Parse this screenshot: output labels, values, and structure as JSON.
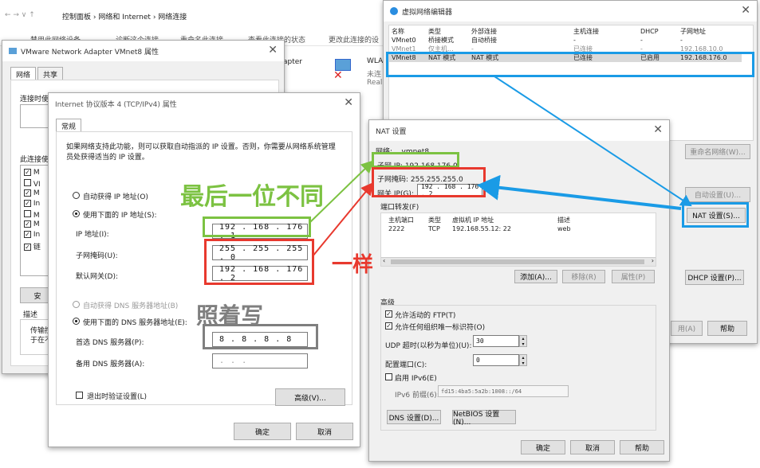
{
  "background_window": {
    "breadcrumb": [
      "控制面板",
      "网络和 Internet",
      "网络连接"
    ],
    "toolbar_items": [
      "禁用此网络设备",
      "诊断这个连接",
      "重命名此连接",
      "查看此连接的状态",
      "更改此连接的设"
    ],
    "adapter_partial": "apter",
    "wlan_partial": [
      "WLA",
      "未连",
      "Real"
    ]
  },
  "vmware_props": {
    "title": "VMware Network Adapter VMnet8 属性",
    "tabs": [
      "网络",
      "共享"
    ],
    "connect_using_partial": "连接时使",
    "this_connection_partial": "此连接使",
    "list_partial": [
      "M",
      "VI",
      "M",
      "In",
      "M",
      "M",
      "In",
      "链"
    ],
    "install_partial": "安",
    "desc_label": "描述",
    "desc_partial": [
      "传输控",
      "于在不"
    ]
  },
  "ipv4": {
    "title": "Internet 协议版本 4 (TCP/IPv4) 属性",
    "tab": "常规",
    "intro": "如果网络支持此功能，则可以获取自动指派的 IP 设置。否则，你需要从网络系统管理员处获得适当的 IP 设置。",
    "auto_ip": "自动获得 IP 地址(O)",
    "manual_ip": "使用下面的 IP 地址(S):",
    "ip_label": "IP 地址(I):",
    "ip_value": "192 . 168 . 176 .  1",
    "mask_label": "子网掩码(U):",
    "mask_value": "255 . 255 . 255 .  0",
    "gw_label": "默认网关(D):",
    "gw_value": "192 . 168 . 176 .  2",
    "auto_dns": "自动获得 DNS 服务器地址(B)",
    "manual_dns": "使用下面的 DNS 服务器地址(E):",
    "dns1_label": "首选 DNS 服务器(P):",
    "dns1_value": "8  .  8  .  8  .  8",
    "dns2_label": "备用 DNS 服务器(A):",
    "dns2_value": " .      .      .",
    "validate": "退出时验证设置(L)",
    "advanced": "高级(V)...",
    "ok": "确定",
    "cancel": "取消"
  },
  "vne": {
    "title": "虚拟网络编辑器",
    "headers": [
      "名称",
      "类型",
      "外部连接",
      "主机连接",
      "DHCP",
      "子网地址"
    ],
    "rows": [
      [
        "VMnet0",
        "桥接模式",
        "自动桥接",
        "-",
        "-",
        "-"
      ],
      [
        "VMnet1",
        "仅主机...",
        "-",
        "已连接",
        "-",
        "192.168.10.0"
      ],
      [
        "VMnet8",
        "NAT 模式",
        "NAT 模式",
        "已连接",
        "已启用",
        "192.168.176.0"
      ]
    ],
    "rename_net": "重命名网络(W)...",
    "auto_settings": "自动设置(U)...",
    "nat_settings": "NAT 设置(S)...",
    "dhcp_settings": "DHCP 设置(P)...",
    "apply_partial": "用(A)",
    "help": "帮助"
  },
  "nat": {
    "title": "NAT 设置",
    "network_label": "网络:",
    "network_value": "vmnet8",
    "subnet_ip": "子网 IP:   192.168.176.0",
    "subnet_mask": "子网掩码:  255.255.255.0",
    "gateway_label": "网关 IP(G):",
    "gateway_value": "192 . 168 . 176 .  2",
    "port_fwd": "端口转发(F)",
    "pf_headers": [
      "主机端口",
      "类型",
      "虚拟机 IP 地址",
      "描述"
    ],
    "pf_row": [
      "2222",
      "TCP",
      "192.168.55.12: 22",
      "web"
    ],
    "add": "添加(A)...",
    "remove": "移除(R)",
    "props": "属性(P)",
    "advanced": "高级",
    "allow_ftp": "允许活动的 FTP(T)",
    "allow_org": "允许任何组织唯一标识符(O)",
    "udp_label": "UDP 超时(以秒为单位)(U):",
    "udp_value": "30",
    "config_port_label": "配置端口(C):",
    "config_port_value": "0",
    "ipv6_enable": "启用 IPv6(E)",
    "ipv6_prefix_label": "IPv6 前缀(6):",
    "ipv6_prefix_value": "fd15:4ba5:5a2b:1008::/64",
    "dns_settings": "DNS 设置(D)...",
    "netbios": "NetBIOS 设置(N)...",
    "ok": "确定",
    "cancel": "取消",
    "help": "帮助"
  },
  "annotations": {
    "last_diff": "最后一位不同",
    "same": "一样",
    "copy": "照着写"
  },
  "colors": {
    "green": "#7cc242",
    "red": "#e8392e",
    "blue": "#1a9be6",
    "gray": "#7f7f7f"
  }
}
